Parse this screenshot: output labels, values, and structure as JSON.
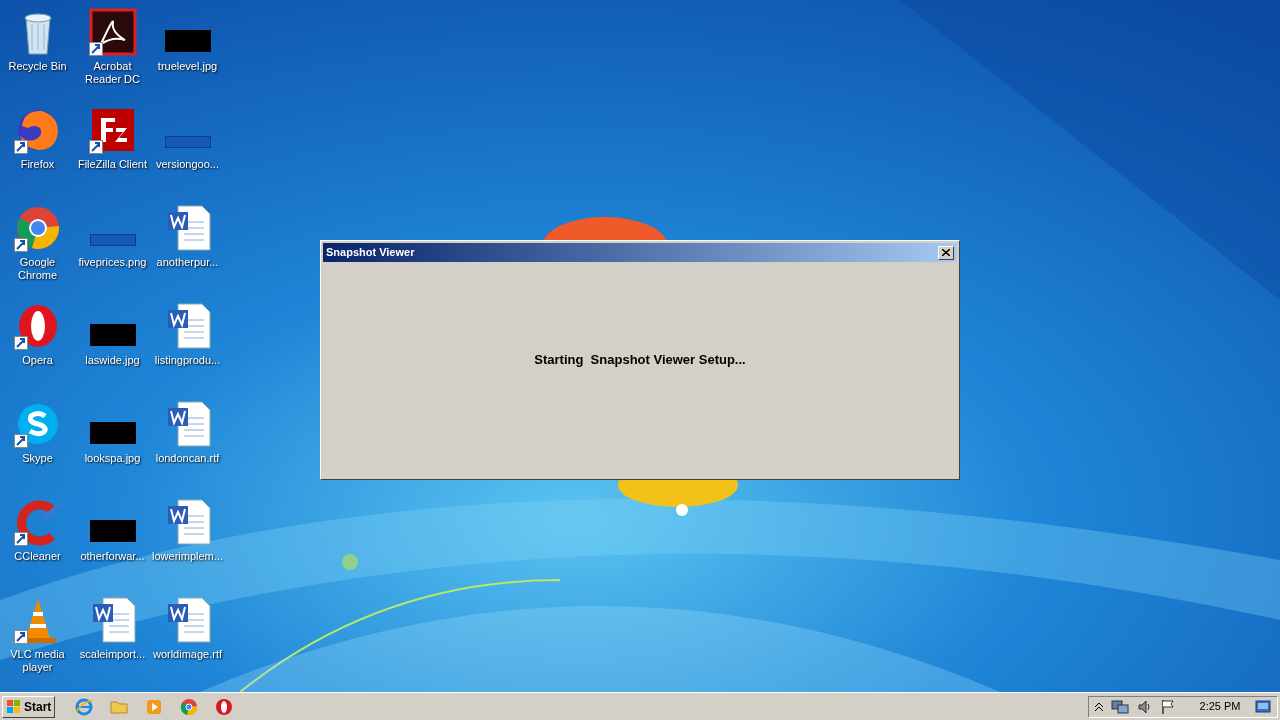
{
  "desktop_icons": [
    {
      "label": "Recycle Bin",
      "kind": "recycle",
      "shortcut": false
    },
    {
      "label": "Firefox",
      "kind": "firefox",
      "shortcut": true
    },
    {
      "label": "Google Chrome",
      "kind": "chrome",
      "shortcut": true
    },
    {
      "label": "Opera",
      "kind": "opera",
      "shortcut": true
    },
    {
      "label": "Skype",
      "kind": "skype",
      "shortcut": true
    },
    {
      "label": "CCleaner",
      "kind": "ccleaner",
      "shortcut": true
    },
    {
      "label": "VLC media player",
      "kind": "vlc",
      "shortcut": true
    },
    {
      "label": "Acrobat Reader DC",
      "kind": "pdf",
      "shortcut": true
    },
    {
      "label": "FileZilla Client",
      "kind": "filezilla",
      "shortcut": true
    },
    {
      "label": "fiveprices.png",
      "kind": "image-blue",
      "shortcut": false
    },
    {
      "label": "laswide.jpg",
      "kind": "image-black",
      "shortcut": false
    },
    {
      "label": "lookspa.jpg",
      "kind": "image-black",
      "shortcut": false
    },
    {
      "label": "otherforwar...",
      "kind": "image-black",
      "shortcut": false
    },
    {
      "label": "scaleimport...",
      "kind": "word",
      "shortcut": false
    },
    {
      "label": "truelevel.jpg",
      "kind": "image-black",
      "shortcut": false
    },
    {
      "label": "versiongoo...",
      "kind": "image-blue",
      "shortcut": false
    },
    {
      "label": "anotherpur...",
      "kind": "word",
      "shortcut": false
    },
    {
      "label": "listingprodu...",
      "kind": "word",
      "shortcut": false
    },
    {
      "label": "londoncan.rtf",
      "kind": "word",
      "shortcut": false
    },
    {
      "label": "lowerimplem...",
      "kind": "word",
      "shortcut": false
    },
    {
      "label": "worldimage.rtf",
      "kind": "word",
      "shortcut": false
    }
  ],
  "dialog": {
    "title": "Snapshot Viewer",
    "message": "Starting  Snapshot Viewer Setup..."
  },
  "taskbar": {
    "start": "Start",
    "quick_launch": [
      {
        "kind": "ie"
      },
      {
        "kind": "folder"
      },
      {
        "kind": "media"
      },
      {
        "kind": "chrome"
      },
      {
        "kind": "opera"
      }
    ],
    "clock": "2:25 PM"
  }
}
